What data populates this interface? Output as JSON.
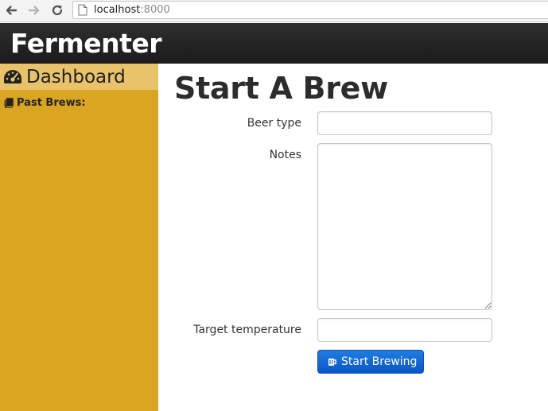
{
  "browser": {
    "url_host": "localhost",
    "url_port": ":8000"
  },
  "header": {
    "brand": "Fermenter"
  },
  "sidebar": {
    "items": [
      {
        "label": "Dashboard",
        "icon": "dashboard-gauge-icon",
        "active": true
      },
      {
        "label": "Past Brews:",
        "icon": "book-icon",
        "active": false
      }
    ],
    "background": "#daa520",
    "active_background": "#e8c36a"
  },
  "main": {
    "title": "Start A Brew",
    "form": {
      "beer_type": {
        "label": "Beer type",
        "value": "",
        "placeholder": ""
      },
      "notes": {
        "label": "Notes",
        "value": "",
        "placeholder": ""
      },
      "target_temperature": {
        "label": "Target temperature",
        "value": "",
        "placeholder": ""
      },
      "submit": {
        "label": "Start Brewing",
        "icon": "beer-mug-icon",
        "color": "#0a56c8"
      }
    }
  }
}
